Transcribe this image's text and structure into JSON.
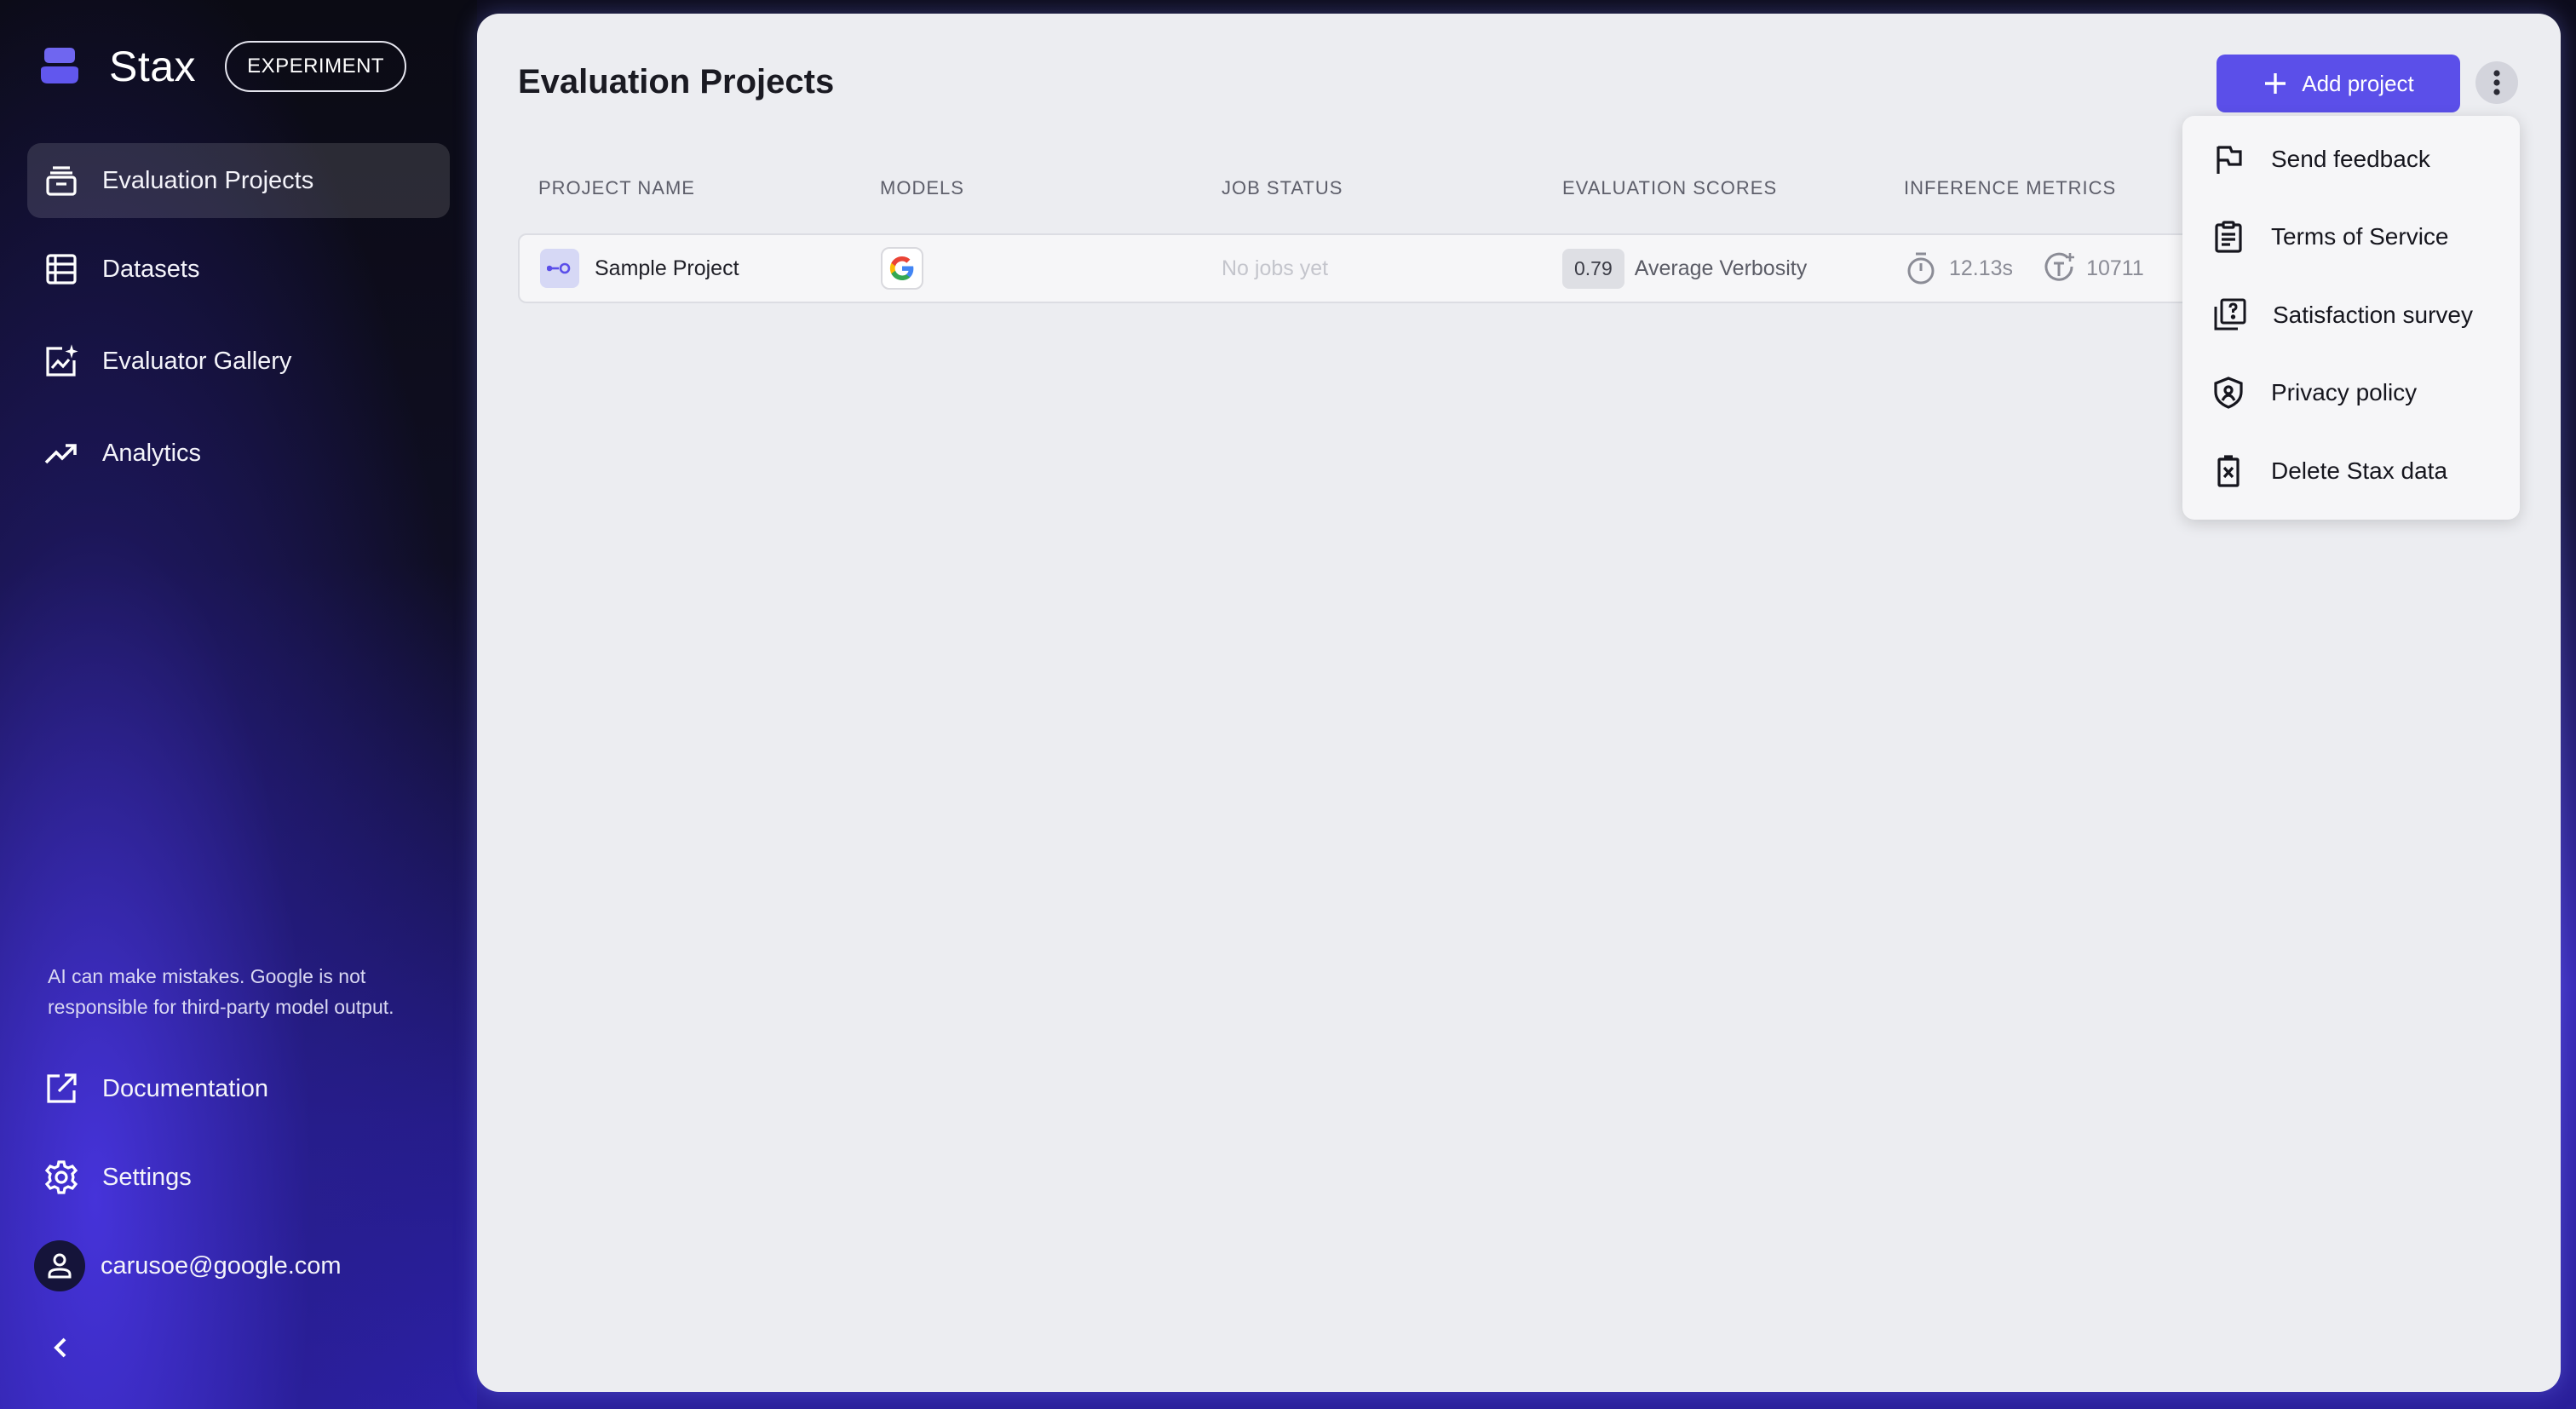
{
  "app": {
    "name": "Stax",
    "badge": "EXPERIMENT",
    "accent": "#5b4fe9"
  },
  "sidebar": {
    "items": [
      {
        "label": "Evaluation Projects",
        "icon": "projects-icon",
        "active": true
      },
      {
        "label": "Datasets",
        "icon": "dataset-icon"
      },
      {
        "label": "Evaluator Gallery",
        "icon": "evaluator-gallery-icon"
      },
      {
        "label": "Analytics",
        "icon": "trending-up-icon"
      }
    ],
    "disclaimer": "AI can make mistakes. Google is not responsible for third-party model output.",
    "documentation": "Documentation",
    "settings": "Settings",
    "user_email": "carusoe@google.com"
  },
  "main": {
    "title": "Evaluation Projects",
    "add_button": "Add project",
    "columns": [
      "PROJECT NAME",
      "MODELS",
      "JOB STATUS",
      "EVALUATION SCORES",
      "INFERENCE METRICS"
    ],
    "rows": [
      {
        "project_name": "Sample Project",
        "model_icon": "google-icon",
        "job_status": "No jobs yet",
        "score": "0.79",
        "score_label": "Average Verbosity",
        "latency": "12.13s",
        "tokens": "10711"
      }
    ]
  },
  "menu": {
    "items": [
      {
        "label": "Send feedback",
        "icon": "flag-icon"
      },
      {
        "label": "Terms of Service",
        "icon": "clipboard-icon"
      },
      {
        "label": "Satisfaction survey",
        "icon": "survey-icon"
      },
      {
        "label": "Privacy policy",
        "icon": "shield-icon"
      },
      {
        "label": "Delete Stax data",
        "icon": "delete-data-icon"
      }
    ]
  }
}
